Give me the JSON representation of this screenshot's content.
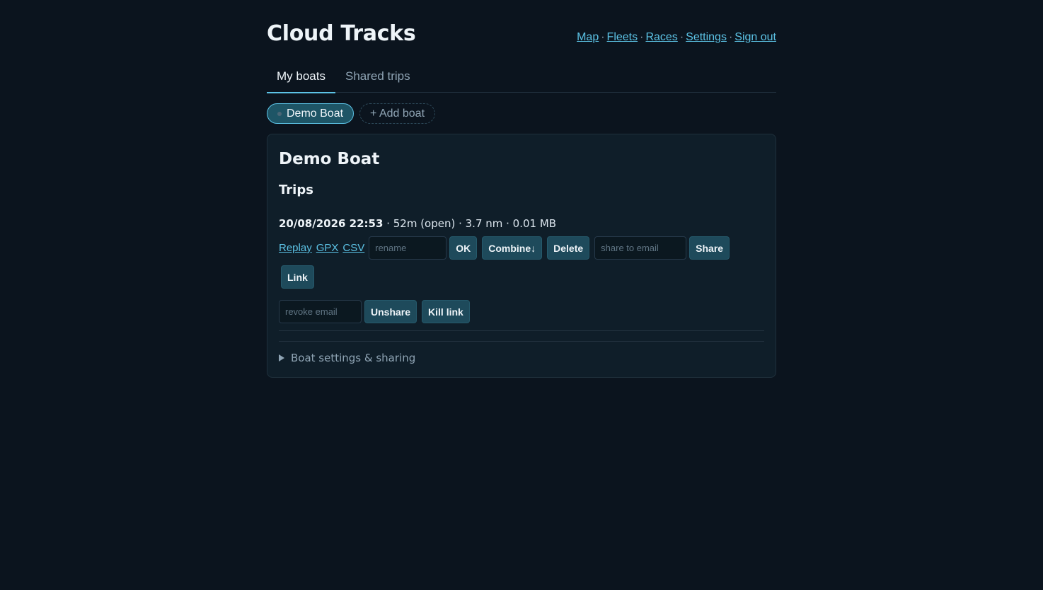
{
  "app": {
    "title": "Cloud Tracks"
  },
  "nav": {
    "links": [
      "Map",
      "Fleets",
      "Races",
      "Settings",
      "Sign out"
    ],
    "separator": "·"
  },
  "tabs": [
    {
      "label": "My boats",
      "active": true
    },
    {
      "label": "Shared trips",
      "active": false
    }
  ],
  "boats": {
    "selected": "Demo Boat",
    "add_label": "+ Add boat"
  },
  "boat": {
    "name": "Demo Boat",
    "trips_heading": "Trips",
    "trip": {
      "date": "20/08/2026 22:53",
      "details": " · 52m (open) · 3.7 nm · 0.01 MB",
      "links": {
        "replay": "Replay",
        "gpx": "GPX",
        "csv": "CSV"
      },
      "rename_placeholder": "rename",
      "ok_label": "OK",
      "combine_label": "Combine↓",
      "delete_label": "Delete",
      "share_placeholder": "share to email",
      "share_label": "Share",
      "link_label": "Link",
      "revoke_placeholder": "revoke email",
      "unshare_label": "Unshare",
      "kill_link_label": "Kill link"
    },
    "settings_summary": "Boat settings & sharing"
  },
  "colors": {
    "background": "#0b141e",
    "card": "#0f1e29",
    "accent": "#5cc3e6",
    "button": "#1e4a5b"
  }
}
